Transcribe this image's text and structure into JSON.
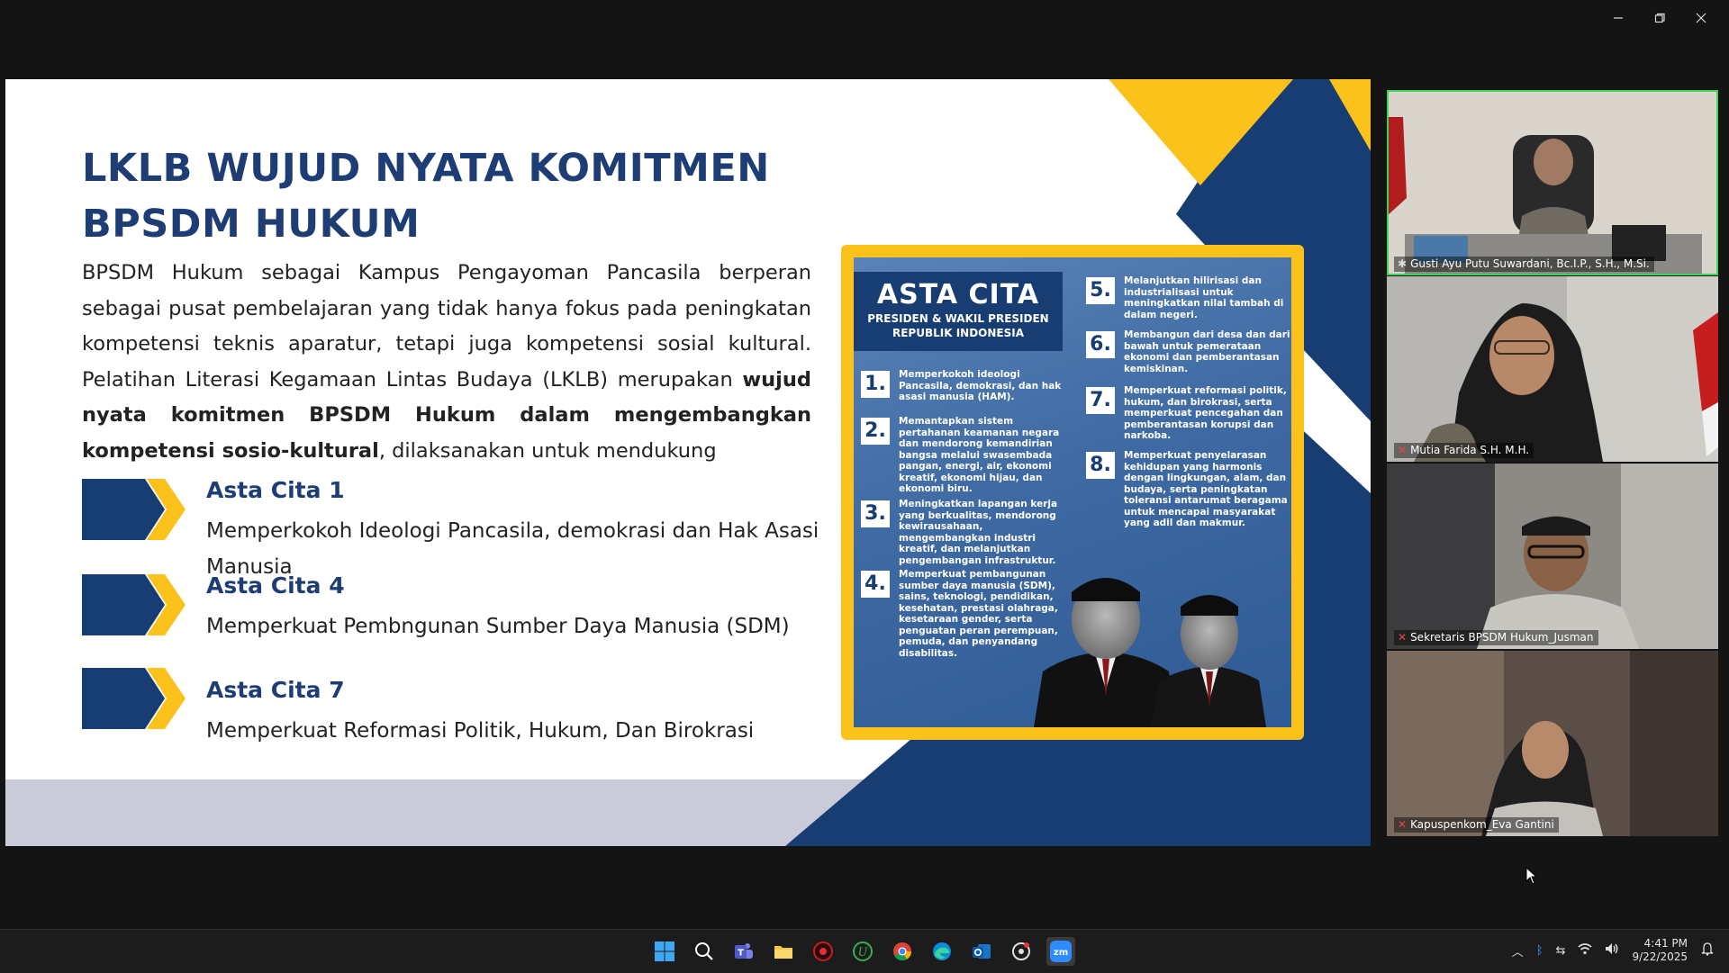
{
  "slide": {
    "title_line1": "LKLB  WUJUD NYATA KOMITMEN",
    "title_line2": "BPSDM HUKUM",
    "para_normal1": "BPSDM Hukum sebagai Kampus Pengayoman Pancasila berperan sebagai pusat pembelajaran yang tidak hanya fokus pada peningkatan kompetensi teknis aparatur, tetapi juga kompetensi sosial kultural. Pelatihan Literasi Kegamaan Lintas Budaya (LKLB) merupakan ",
    "para_bold": "wujud nyata komitmen BPSDM Hukum dalam mengembangkan kompetensi sosio-kultural",
    "para_normal2": ", dilaksanakan untuk mendukung",
    "citas": [
      {
        "title": "Asta Cita 1",
        "desc": "Memperkokoh Ideologi Pancasila, demokrasi dan Hak Asasi Manusia"
      },
      {
        "title": "Asta Cita 4",
        "desc": "Memperkuat Pembngunan Sumber Daya Manusia (SDM)"
      },
      {
        "title": "Asta Cita 7",
        "desc": "Memperkuat Reformasi Politik, Hukum, Dan Birokrasi"
      }
    ],
    "colors": {
      "navy": "#1d3d74",
      "gold": "#fbc21b",
      "gray_band": "#c9ccd8"
    }
  },
  "poster": {
    "heading": "ASTA CITA",
    "subheading1": "PRESIDEN & WAKIL PRESIDEN",
    "subheading2": "REPUBLIK INDONESIA",
    "items": [
      {
        "num": "1.",
        "text": "Memperkokoh ideologi Pancasila, demokrasi, dan hak asasi manusia (HAM)."
      },
      {
        "num": "2.",
        "text": "Memantapkan sistem pertahanan keamanan negara dan mendorong kemandirian bangsa melalui swasembada pangan, energi, air, ekonomi kreatif, ekonomi hijau, dan ekonomi biru."
      },
      {
        "num": "3.",
        "text": "Meningkatkan lapangan kerja yang berkualitas, mendorong kewirausahaan, mengembangkan industri kreatif, dan melanjutkan pengembangan infrastruktur."
      },
      {
        "num": "4.",
        "text": "Memperkuat pembangunan sumber daya manusia (SDM), sains, teknologi, pendidikan, kesehatan, prestasi olahraga, kesetaraan gender, serta penguatan peran perempuan, pemuda, dan penyandang disabilitas."
      },
      {
        "num": "5.",
        "text": "Melanjutkan hilirisasi dan industrialisasi untuk meningkatkan nilai tambah di dalam negeri."
      },
      {
        "num": "6.",
        "text": "Membangun dari desa dan dari bawah untuk pemerataan ekonomi dan pemberantasan kemiskinan."
      },
      {
        "num": "7.",
        "text": "Memperkuat reformasi politik, hukum, dan birokrasi, serta memperkuat pencegahan dan pemberantasan korupsi dan narkoba."
      },
      {
        "num": "8.",
        "text": "Memperkuat penyelarasan kehidupan yang harmonis dengan lingkungan, alam, dan budaya, serta peningkatan toleransi antarumat beragama untuk mencapai masyarakat yang adil dan makmur."
      }
    ]
  },
  "participants": [
    {
      "name": "Gusti Ayu Putu Suwardani, Bc.I.P., S.H., M.Si.",
      "active": true,
      "muted": false
    },
    {
      "name": "Mutia Farida S.H. M.H.",
      "active": false,
      "muted": true
    },
    {
      "name": "Sekretaris BPSDM Hukum_Jusman",
      "active": false,
      "muted": true
    },
    {
      "name": "Kapuspenkom_Eva Gantini",
      "active": false,
      "muted": true
    }
  ],
  "taskbar": {
    "icons": [
      "windows-start-icon",
      "search-icon",
      "teams-icon",
      "file-explorer-icon",
      "app-red-icon",
      "app-green-icon",
      "chrome-icon",
      "edge-icon",
      "outlook-icon",
      "app-launcher-icon",
      "zoom-icon"
    ],
    "zoom_label": "zm",
    "time": "4:41 PM",
    "date": "9/22/2025"
  }
}
